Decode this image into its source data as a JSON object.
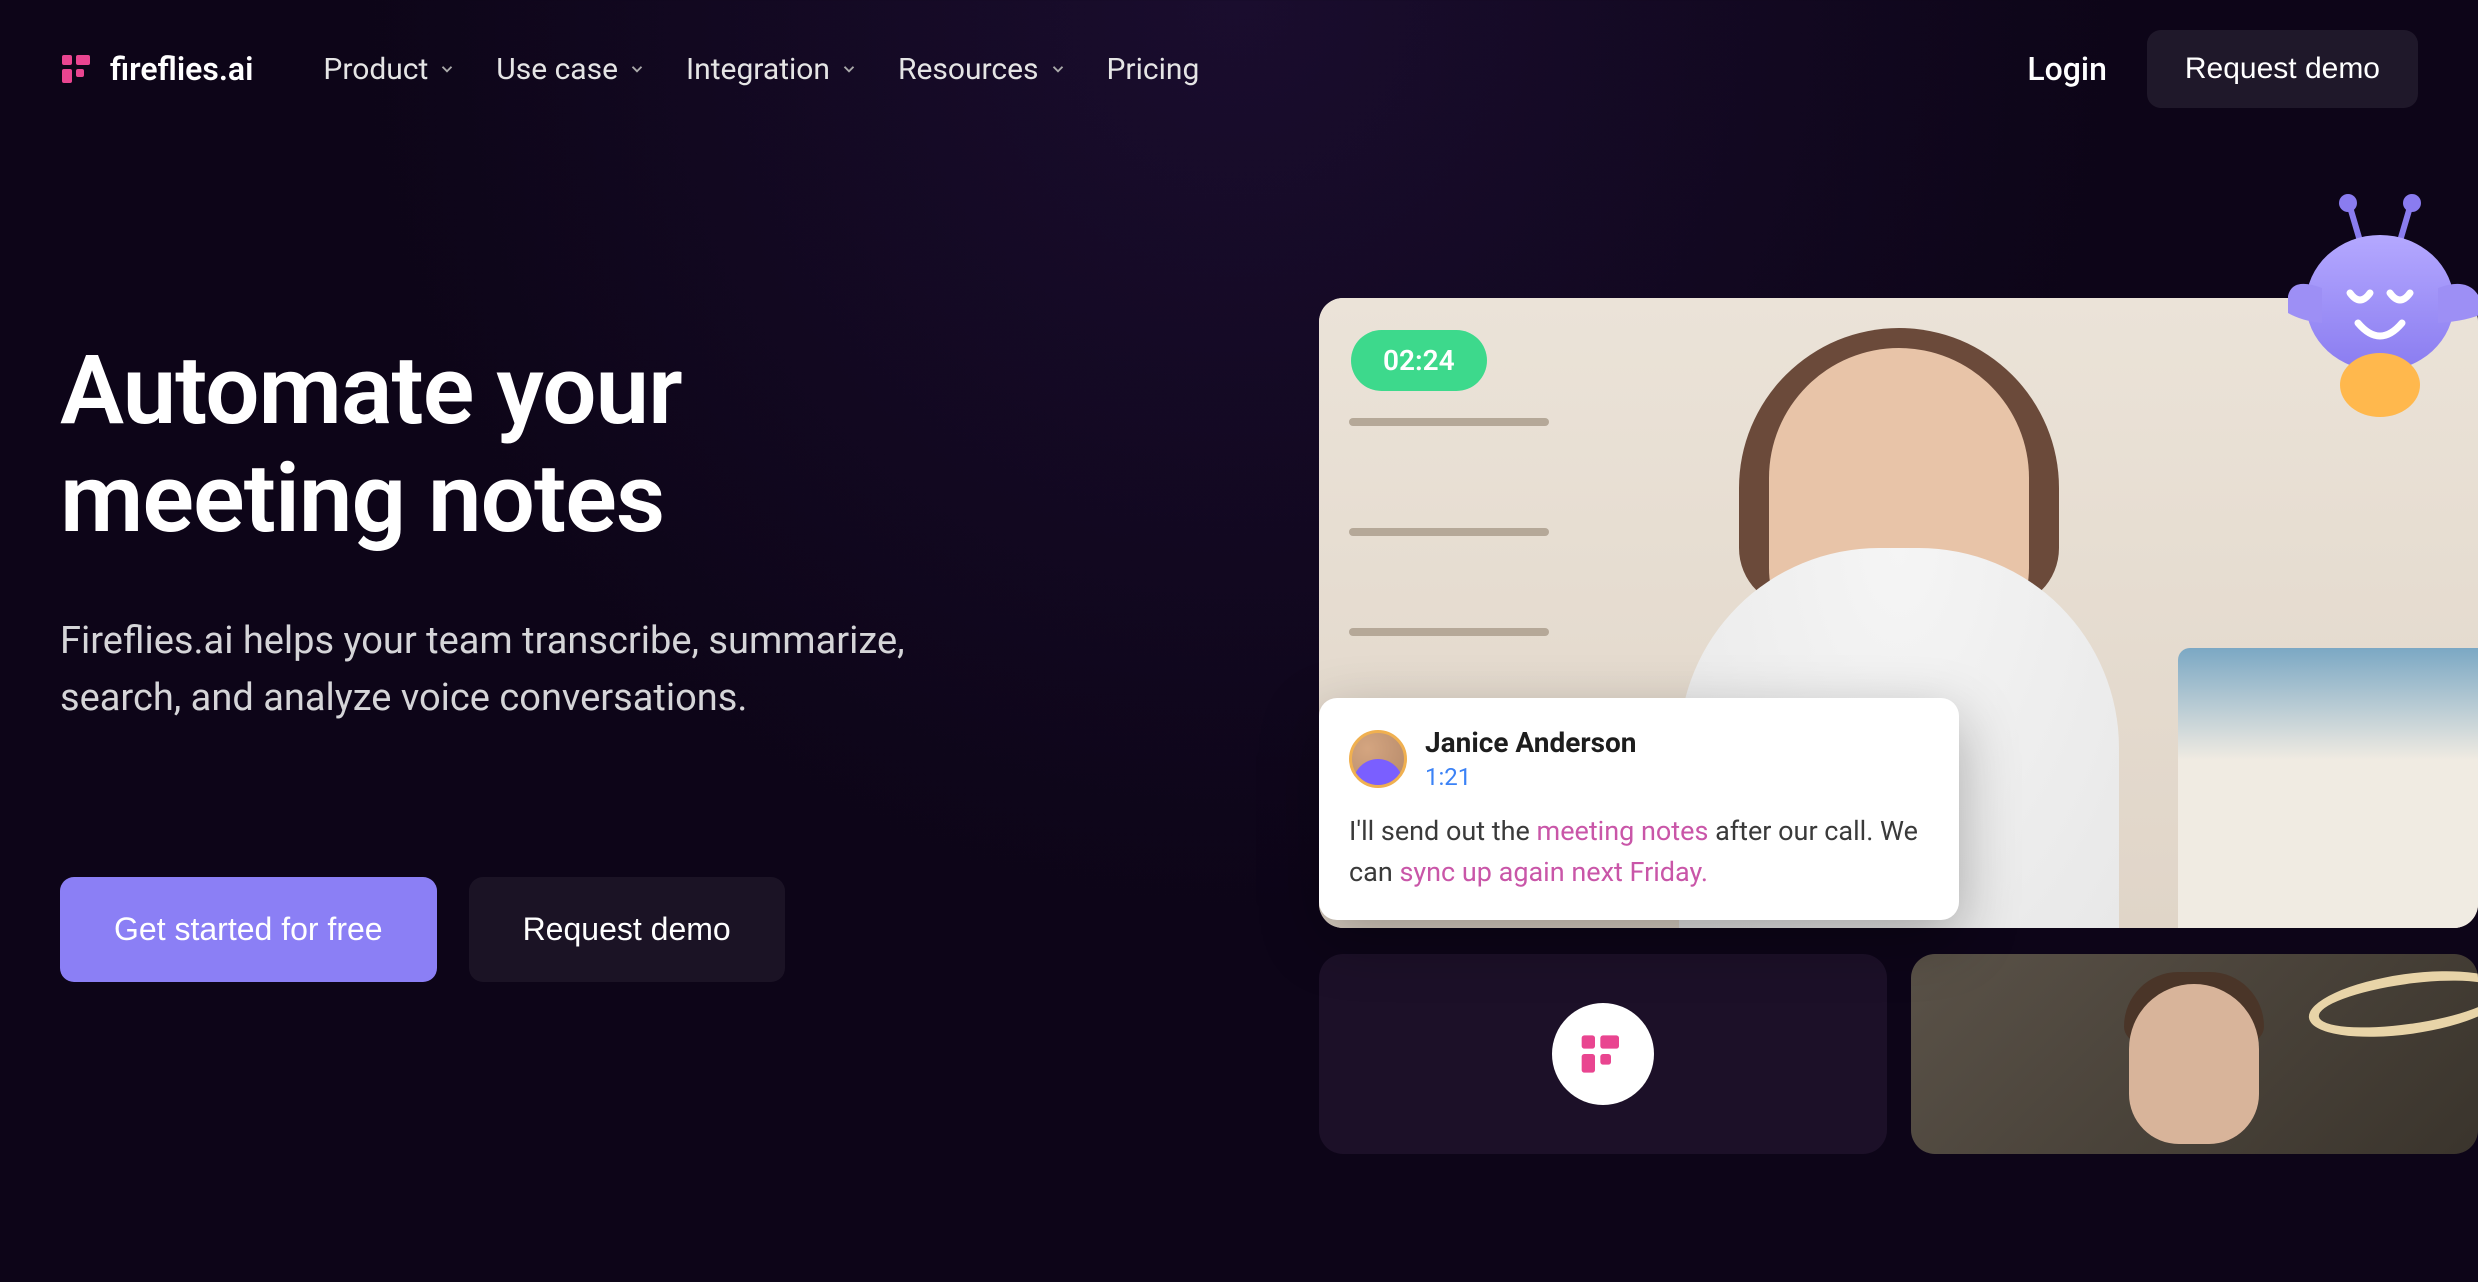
{
  "brand": {
    "name": "fireflies.ai"
  },
  "nav": {
    "items": [
      {
        "label": "Product",
        "dropdown": true
      },
      {
        "label": "Use case",
        "dropdown": true
      },
      {
        "label": "Integration",
        "dropdown": true
      },
      {
        "label": "Resources",
        "dropdown": true
      },
      {
        "label": "Pricing",
        "dropdown": false
      }
    ],
    "login": "Login",
    "request_demo": "Request demo"
  },
  "hero": {
    "title_line1": "Automate your",
    "title_line2": "meeting notes",
    "subtitle": "Fireflies.ai helps your team transcribe, summarize, search, and analyze voice conversations.",
    "cta_primary": "Get started for free",
    "cta_secondary": "Request demo"
  },
  "video": {
    "timer": "02:24"
  },
  "transcript": {
    "speaker": "Janice Anderson",
    "timestamp": "1:21",
    "text_pre": "I'll send out the ",
    "highlight1": "meeting notes",
    "text_mid": " after our call. We can ",
    "highlight2": "sync up again next Friday.",
    "text_post": ""
  },
  "colors": {
    "accent": "#8b7ff5",
    "highlight": "#c956a8",
    "timer_bg": "#3dd98c"
  }
}
